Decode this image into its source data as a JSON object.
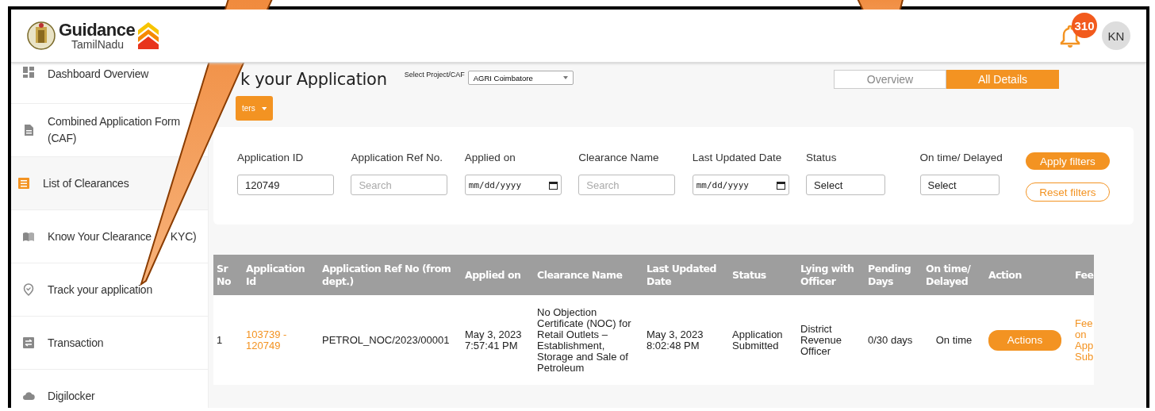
{
  "header": {
    "logo_title": "Guidance",
    "logo_subtitle": "TamilNadu",
    "notification_count": "310",
    "avatar_initials": "KN"
  },
  "sidebar": {
    "items": [
      {
        "label": "Dashboard Overview",
        "selected": false
      },
      {
        "label": "Combined Application Form (CAF)",
        "selected": false
      },
      {
        "label": "List of Clearances",
        "selected": true
      },
      {
        "label": "Know Your Clearance",
        "label_tail": "KYC)",
        "selected": false
      },
      {
        "label": "Track your application",
        "selected": false
      },
      {
        "label": "Transaction",
        "selected": false
      },
      {
        "label": "Digilocker",
        "selected": false
      }
    ]
  },
  "page": {
    "title": "k your Application",
    "project_label": "Select Project/CAF",
    "project_value": "AGRI Coimbatore",
    "filters_button": "ters",
    "tabs": [
      {
        "label": "Overview",
        "selected": false
      },
      {
        "label": "All Details",
        "selected": true
      }
    ]
  },
  "filters": {
    "fields": [
      {
        "label": "Application ID",
        "kind": "text",
        "value": "120749"
      },
      {
        "label": "Application Ref No.",
        "kind": "text",
        "placeholder": "Search"
      },
      {
        "label": "Applied on",
        "kind": "date",
        "placeholder": "mm/dd/yyyy"
      },
      {
        "label": "Clearance Name",
        "kind": "text",
        "placeholder": "Search"
      },
      {
        "label": "Last Updated Date",
        "kind": "date",
        "placeholder": "mm/dd/yyyy"
      },
      {
        "label": "Status",
        "kind": "select",
        "value": "Select"
      },
      {
        "label": "On time/ Delayed",
        "kind": "select",
        "value": "Select"
      }
    ],
    "apply_button": "Apply filters",
    "reset_button": "Reset filters"
  },
  "table": {
    "columns": [
      "Sr No",
      "Application Id",
      "Application Ref No (from dept.)",
      "Applied on",
      "Clearance Name",
      "Last Updated Date",
      "Status",
      "Lying with Officer",
      "Pending Days",
      "On time/ Delayed",
      "Action",
      "Fee"
    ],
    "rows": [
      {
        "sr_no": "1",
        "application_id": "103739 - 120749",
        "ref_no": "PETROL_NOC/2023/00001",
        "applied_on": "May 3, 2023 7:57:41 PM",
        "clearance_name": "No Objection Certificate (NOC) for Retail Outlets – Establishment, Storage and Sale of Petroleum",
        "last_updated": "May 3, 2023 8:02:48 PM",
        "status": "Application Submitted",
        "lying_with": "District Revenue Officer",
        "pending_days": "0/30 days",
        "on_time": "On time",
        "action": "Actions",
        "fee": "Fee on App Sub"
      }
    ]
  }
}
